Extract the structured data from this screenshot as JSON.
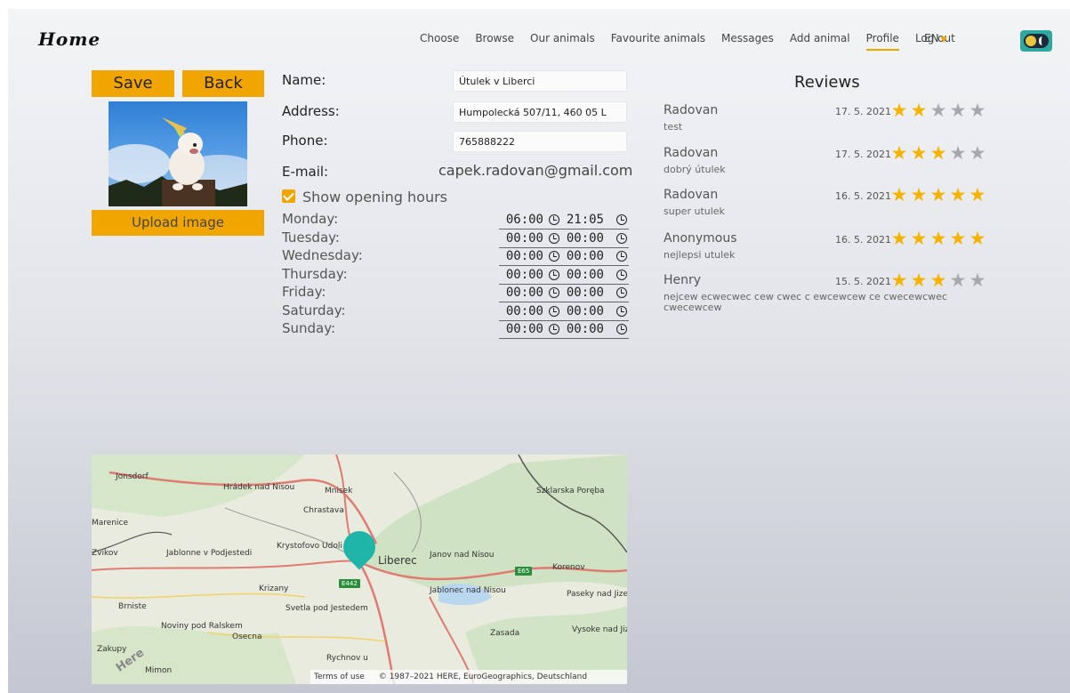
{
  "header": {
    "brand": "Home",
    "nav": [
      "Choose",
      "Browse",
      "Our animals",
      "Favourite animals",
      "Messages",
      "Add animal",
      "Profile",
      "Log out"
    ],
    "active_nav": "Profile",
    "language": "EN"
  },
  "actions": {
    "save": "Save",
    "back": "Back",
    "upload": "Upload image"
  },
  "form": {
    "name_label": "Name:",
    "name_value": "Útulek v Liberci",
    "address_label": "Address:",
    "address_value": "Humpolecká 507/11, 460 05 L",
    "phone_label": "Phone:",
    "phone_value": "765888222",
    "email_label": "E-mail:",
    "email_value": "capek.radovan@gmail.com",
    "show_hours_label": "Show opening hours",
    "show_hours_checked": true
  },
  "hours": [
    {
      "day": "Monday:",
      "open": "06:00",
      "close": "21:05"
    },
    {
      "day": "Tuesday:",
      "open": "00:00",
      "close": "00:00"
    },
    {
      "day": "Wednesday:",
      "open": "00:00",
      "close": "00:00"
    },
    {
      "day": "Thursday:",
      "open": "00:00",
      "close": "00:00"
    },
    {
      "day": "Friday:",
      "open": "00:00",
      "close": "00:00"
    },
    {
      "day": "Saturday:",
      "open": "00:00",
      "close": "00:00"
    },
    {
      "day": "Sunday:",
      "open": "00:00",
      "close": "00:00"
    }
  ],
  "reviews": {
    "title": "Reviews",
    "items": [
      {
        "name": "Radovan",
        "text": "test",
        "date": "17. 5. 2021",
        "rating": 2
      },
      {
        "name": "Radovan",
        "text": "dobrý útulek",
        "date": "17. 5. 2021",
        "rating": 3
      },
      {
        "name": "Radovan",
        "text": "super utulek",
        "date": "16. 5. 2021",
        "rating": 5
      },
      {
        "name": "Anonymous",
        "text": "nejlepsi utulek",
        "date": "16. 5. 2021",
        "rating": 5
      },
      {
        "name": "Henry",
        "text": "nejcew ecwecwec cew cwec c ewcewcew ce cwecewcwec cwecewcew",
        "date": "15. 5. 2021",
        "rating": 3
      }
    ]
  },
  "map": {
    "towns": [
      "Jonsdorf",
      "Hrádek nad Nisou",
      "Mnisek",
      "Chrastava",
      "Szklarska Poręba",
      "Marenice",
      "Krystofovo Udoli",
      "Liberec",
      "Janov nad Nisou",
      "Korenov",
      "Zvikov",
      "Jablonne v Podjestedi",
      "Krizany",
      "Jablonec nad Nisou",
      "Paseky nad Jizerou",
      "Brniste",
      "Svetla pod Jestedem",
      "Noviny pod Ralskem",
      "Osecna",
      "Zasada",
      "Vysoke nad Jizerou",
      "Zakupy",
      "Mimon",
      "Rychnov u"
    ],
    "roads": [
      "E442",
      "E65"
    ],
    "terms": "Terms of use",
    "copyright": "© 1987–2021 HERE, EuroGeographics, Deutschland",
    "watermark": "Here"
  },
  "colors": {
    "accent": "#f0a500",
    "pin": "#1fb5a8",
    "star_on": "#f5b300",
    "star_off": "#a6a8ad"
  }
}
